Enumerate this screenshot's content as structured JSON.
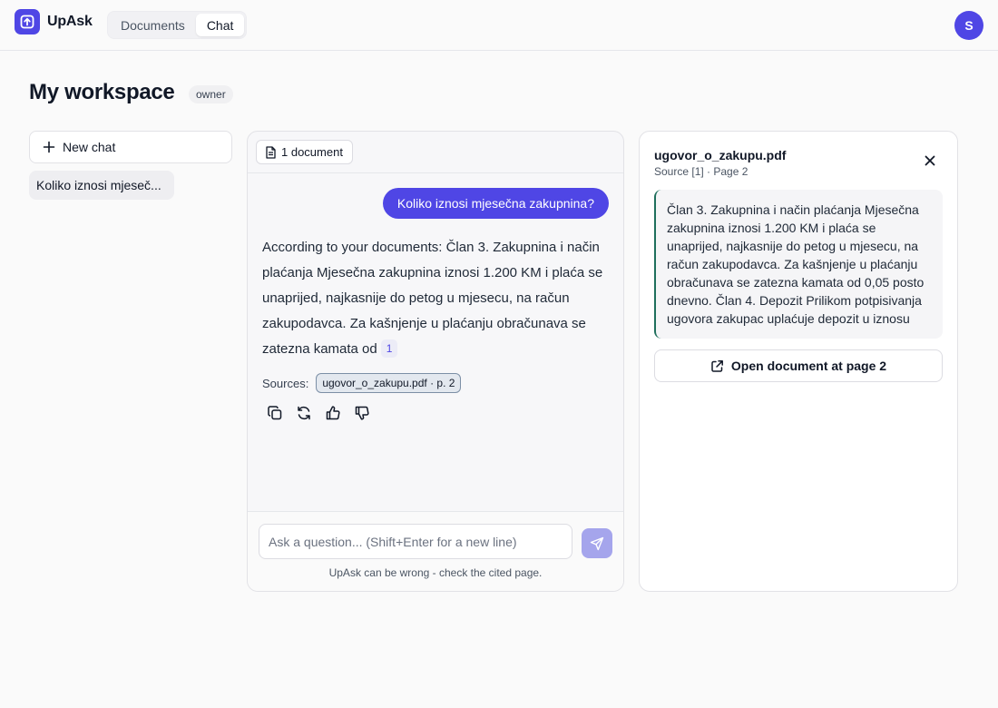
{
  "app": {
    "name": "UpAsk",
    "logo_icon": "upload-arrow-icon",
    "accent": "#4f46e5"
  },
  "nav": {
    "tabs": [
      {
        "label": "Documents",
        "active": false
      },
      {
        "label": "Chat",
        "active": true
      }
    ]
  },
  "user": {
    "avatar_initial": "S"
  },
  "workspace": {
    "title": "My workspace",
    "role": "owner"
  },
  "sidebar": {
    "new_chat_label": "New chat",
    "chats": [
      {
        "label": "Koliko iznosi mjeseč..."
      }
    ]
  },
  "chat": {
    "document_count_label": "1 document",
    "messages": [
      {
        "role": "user",
        "text": "Koliko iznosi mjesečna zakupnina?"
      },
      {
        "role": "assistant",
        "text": "According to your documents: Član 3. Zakupnina i način plaćanja Mjesečna zakupnina iznosi 1.200 KM i plaća se unaprijed, najkasnije do petog u mjesecu, na račun zakupodavca. Za kašnjenje u plaćanju obračunava se zatezna kamata od",
        "citation": "1"
      }
    ],
    "sources_label": "Sources:",
    "sources": [
      {
        "label": "ugovor_o_zakupu.pdf · p. 2"
      }
    ],
    "actions": [
      "copy-icon",
      "regenerate-icon",
      "thumbs-up-icon",
      "thumbs-down-icon"
    ],
    "input_placeholder": "Ask a question... (Shift+Enter for a new line)",
    "input_value": "",
    "disclaimer": "UpAsk can be wrong - check the cited page."
  },
  "source_panel": {
    "filename": "ugovor_o_zakupu.pdf",
    "meta": "Source [1] · Page 2",
    "excerpt": "Član 3. Zakupnina i način plaćanja Mjesečna zakupnina iznosi 1.200 KM i plaća se unaprijed, najkasnije do petog u mjesecu, na račun zakupodavca. Za kašnjenje u plaćanju obračunava se zatezna kamata od 0,05 posto dnevno. Član 4. Depozit Prilikom potpisivanja ugovora zakupac uplaćuje depozit u iznosu",
    "open_button_label": "Open document at page 2"
  }
}
